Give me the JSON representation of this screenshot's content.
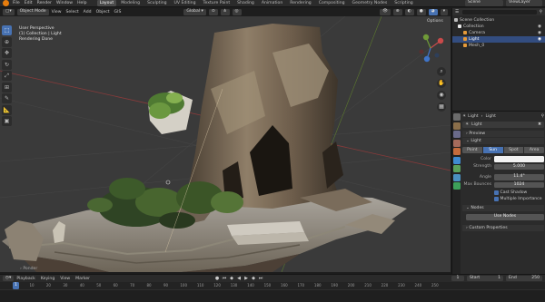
{
  "menu": {
    "items": [
      "File",
      "Edit",
      "Render",
      "Window",
      "Help"
    ],
    "workspaces": [
      "Layout",
      "Modeling",
      "Sculpting",
      "UV Editing",
      "Texture Paint",
      "Shading",
      "Animation",
      "Rendering",
      "Compositing",
      "Geometry Nodes",
      "Scripting"
    ],
    "active_workspace": "Layout",
    "scene": "Scene",
    "view_layer": "ViewLayer"
  },
  "viewport_header": {
    "mode": "Object Mode",
    "menus": [
      "View",
      "Select",
      "Add",
      "Object",
      "GIS"
    ],
    "orientation": "Global",
    "options": "Options"
  },
  "viewport_info": {
    "line1": "User Perspective",
    "line2": "(1) Collection | Light",
    "line3": "Rendering Done"
  },
  "viewport_footer": "Ponder",
  "outliner": {
    "title": "Scene Collection",
    "items": [
      {
        "label": "Collection",
        "color": "#e8e8e8",
        "selected": false,
        "indent": 1
      },
      {
        "label": "Camera",
        "color": "#e59a3a",
        "selected": false,
        "indent": 2
      },
      {
        "label": "Light",
        "color": "#e59a3a",
        "selected": true,
        "indent": 2
      },
      {
        "label": "Mesh_0",
        "color": "#e59a3a",
        "selected": false,
        "indent": 2
      }
    ]
  },
  "properties": {
    "breadcrumb_a": "Light",
    "breadcrumb_b": "Light",
    "datablock": "Light",
    "preview": "Preview",
    "light_section": "Light",
    "light_types": [
      "Point",
      "Sun",
      "Spot",
      "Area"
    ],
    "active_light_type": "Sun",
    "color_label": "Color",
    "strength_label": "Strength",
    "strength_value": "5.000",
    "angle_label": "Angle",
    "angle_value": "11.4°",
    "max_bounces_label": "Max Bounces",
    "max_bounces_value": "1024",
    "cast_shadow": "Cast Shadow",
    "multiple_importance": "Multiple Importance",
    "nodes_section": "Nodes",
    "use_nodes": "Use Nodes",
    "custom_props": "Custom Properties"
  },
  "timeline": {
    "menus": [
      "Playback",
      "Keying",
      "View",
      "Marker"
    ],
    "current_frame": "1",
    "start_label": "Start",
    "start_value": "1",
    "end_label": "End",
    "end_value": "250",
    "ticks": [
      "0",
      "10",
      "20",
      "30",
      "40",
      "50",
      "60",
      "70",
      "80",
      "90",
      "100",
      "110",
      "120",
      "130",
      "140",
      "150",
      "160",
      "170",
      "180",
      "190",
      "200",
      "210",
      "220",
      "230",
      "240",
      "250"
    ]
  },
  "colors": {
    "accent": "#4772b3",
    "orange": "#e87d0d",
    "panel": "#2b2b2b",
    "viewport_bg": "#3a3a3a"
  }
}
